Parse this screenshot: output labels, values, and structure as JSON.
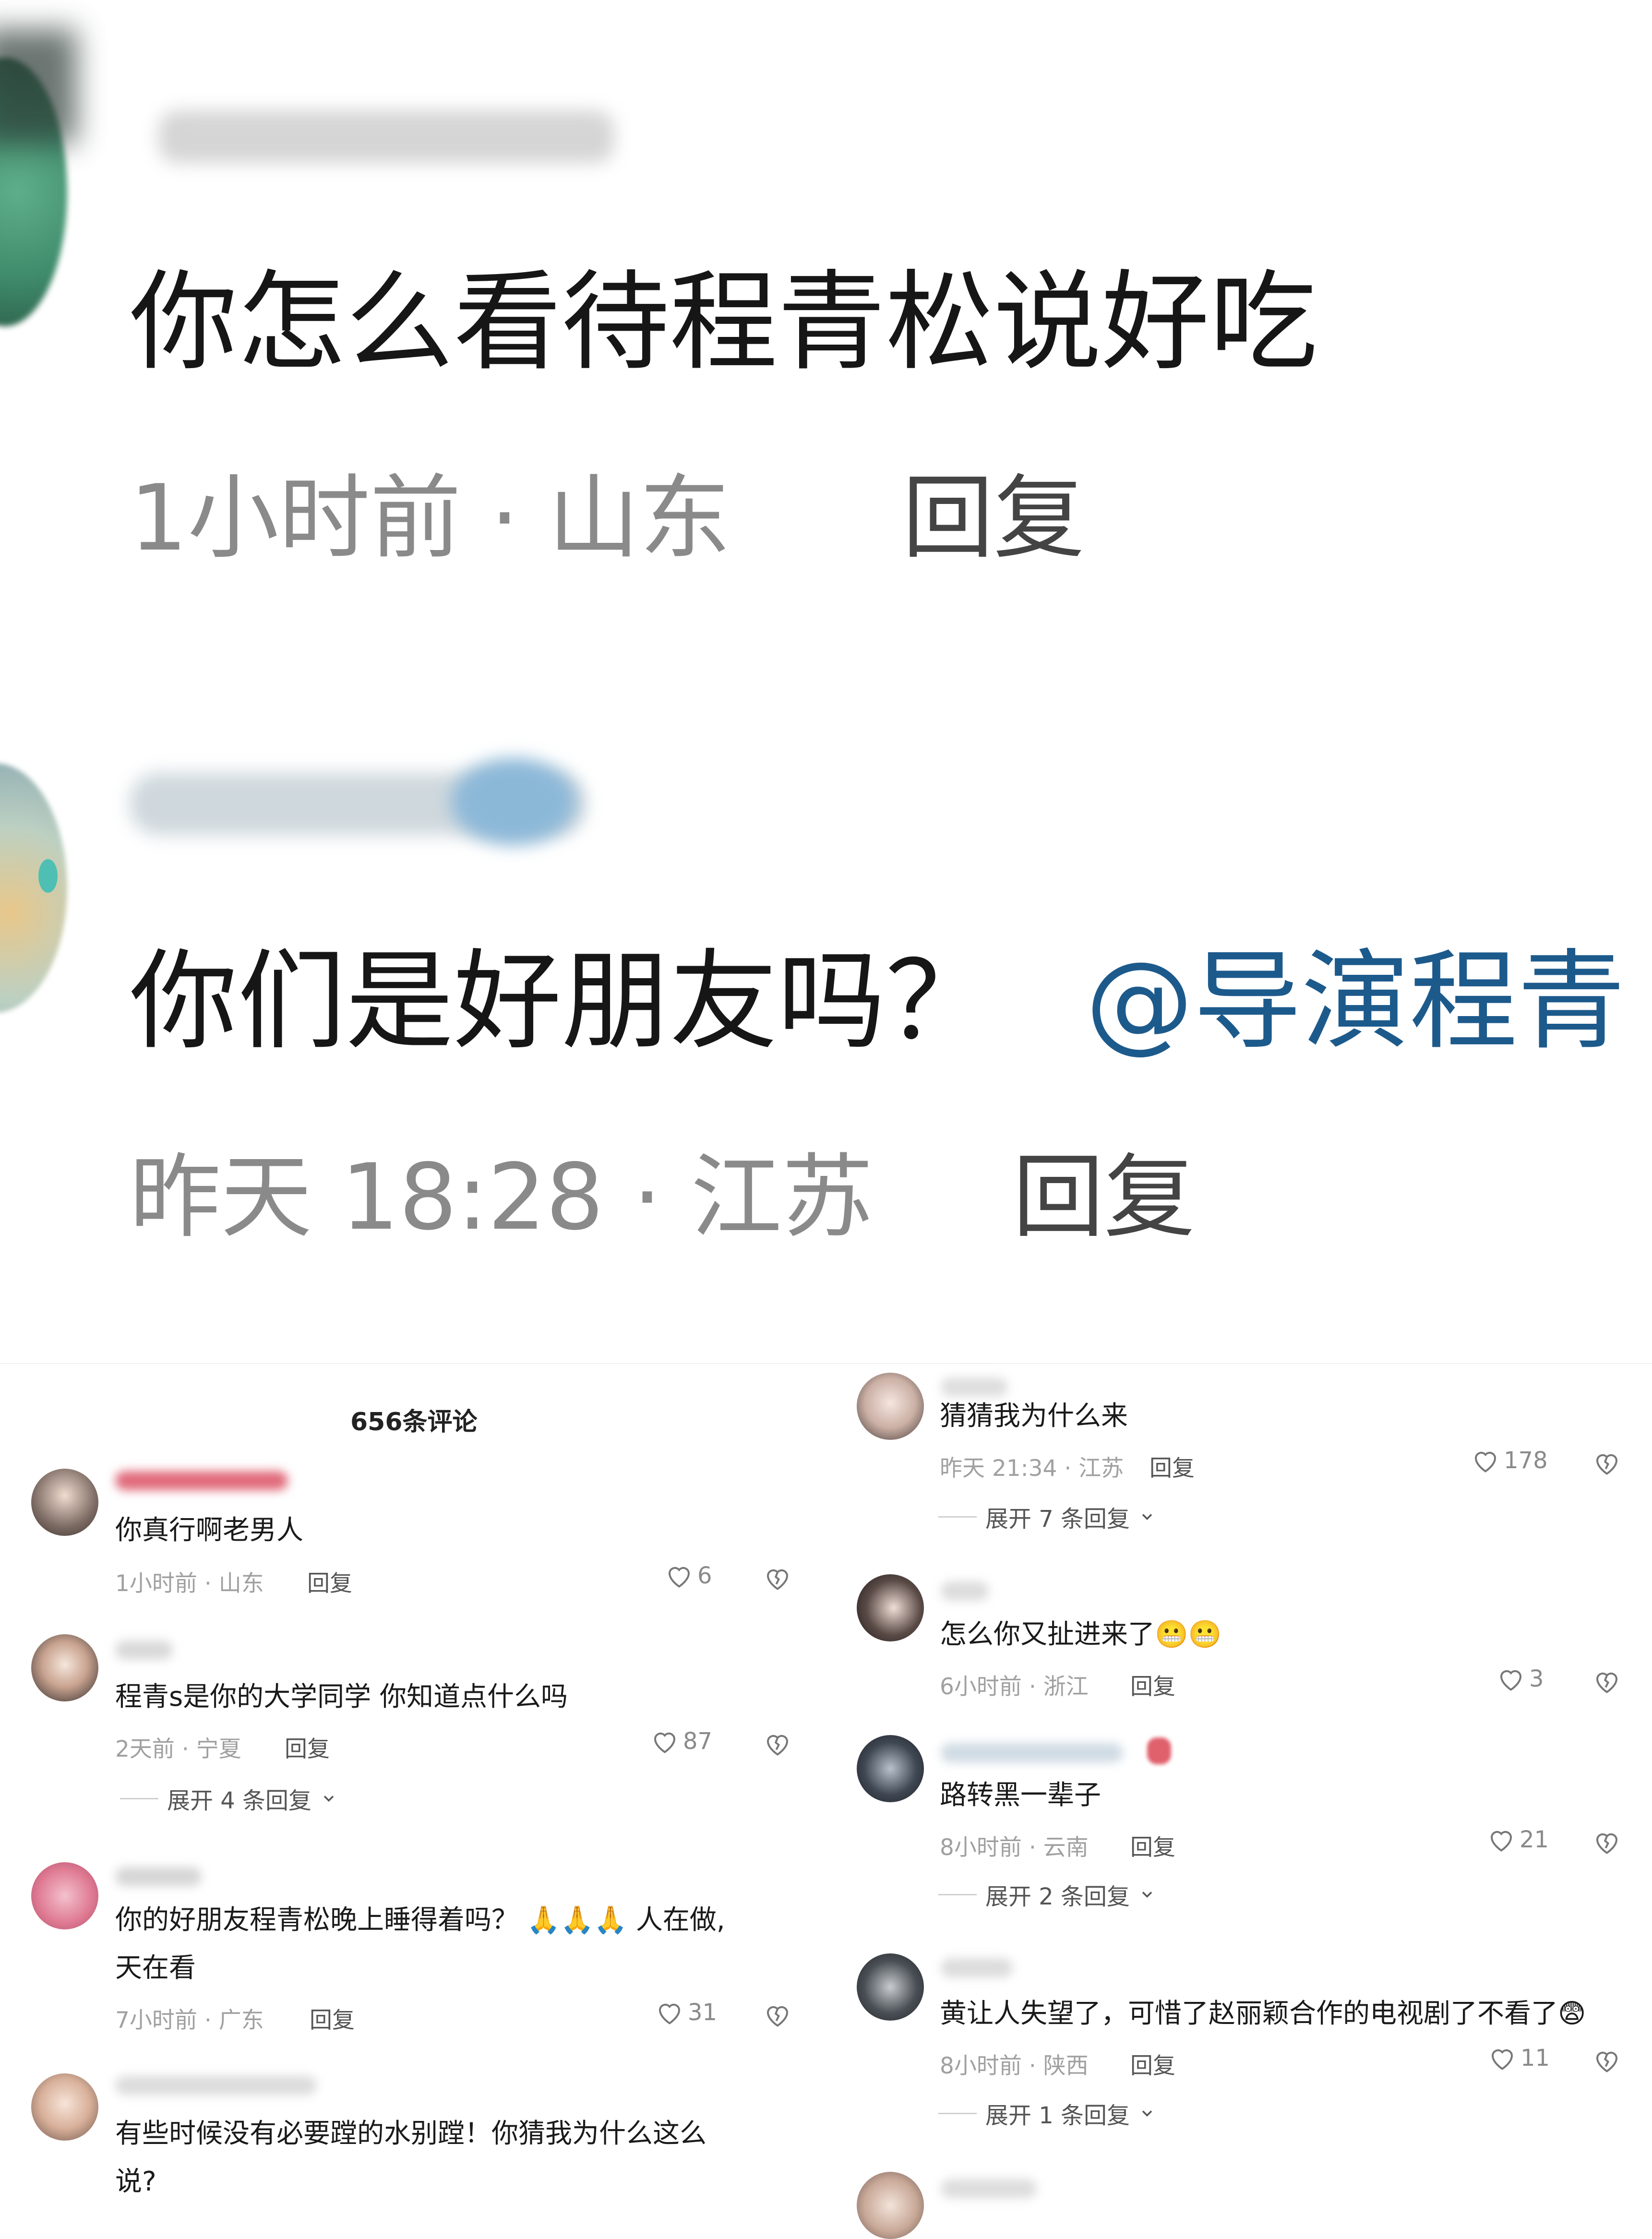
{
  "zoomed": {
    "comment1": {
      "text": "你怎么看待程青松说好吃",
      "meta": "1小时前 · 山东",
      "reply": "回复"
    },
    "comment2": {
      "text": "你们是好朋友吗？",
      "mention": "@导演程青",
      "meta": "昨天 18:28 · 江苏",
      "reply": "回复"
    }
  },
  "panel_left": {
    "title": "656条评论",
    "comments": [
      {
        "text": "你真行啊老男人",
        "meta": "1小时前 · 山东",
        "reply": "回复",
        "likes": "6"
      },
      {
        "text": "程青s是你的大学同学 你知道点什么吗",
        "meta": "2天前 · 宁夏",
        "reply": "回复",
        "likes": "87",
        "expand": "展开 4 条回复"
      },
      {
        "text1": "你的好朋友程青松晚上睡得着吗？",
        "text1b": "人在做,",
        "text2": "天在看",
        "meta": "7小时前 · 广东",
        "reply": "回复",
        "likes": "31"
      },
      {
        "text1": "有些时候没有必要蹚的水别蹚！你猜我为什么这么",
        "text2": "说?"
      }
    ]
  },
  "panel_right": {
    "comments": [
      {
        "text": "猜猜我为什么来",
        "meta": "昨天 21:34 · 江苏",
        "reply": "回复",
        "likes": "178",
        "expand": "展开 7 条回复"
      },
      {
        "text": "怎么你又扯进来了",
        "meta": "6小时前 · 浙江",
        "reply": "回复",
        "likes": "3"
      },
      {
        "text": "路转黑一辈子",
        "meta": "8小时前 · 云南",
        "reply": "回复",
        "likes": "21",
        "expand": "展开 2 条回复"
      },
      {
        "text": "黄让人失望了，可惜了赵丽颖合作的电视剧了不看了",
        "meta": "8小时前 · 陕西",
        "reply": "回复",
        "likes": "11",
        "expand": "展开 1 条回复"
      }
    ]
  },
  "colors": {
    "mention": "#1d5a8c",
    "meta": "#a0a0a0",
    "background": "#ffffff"
  },
  "icons": [
    "heart-icon",
    "broken-heart-icon",
    "chevron-down-icon",
    "pray-emoji",
    "grimace-emoji",
    "fear-emoji"
  ]
}
